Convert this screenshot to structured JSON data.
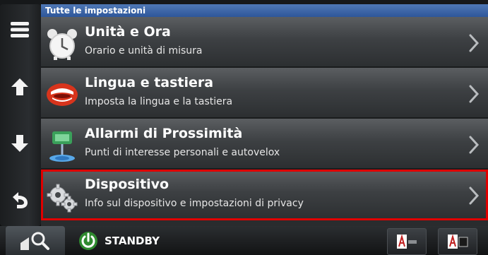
{
  "header": {
    "title": "Tutte le impostazioni"
  },
  "rows": [
    {
      "title": "Unità e Ora",
      "subtitle": "Orario e unità di misura",
      "icon": "alarm-clock-icon"
    },
    {
      "title": "Lingua e tastiera",
      "subtitle": "Imposta la lingua e la tastiera",
      "icon": "mouth-icon"
    },
    {
      "title": "Allarmi di Prossimità",
      "subtitle": "Punti di interesse personali e autovelox",
      "icon": "proximity-alert-icon"
    },
    {
      "title": "Dispositivo",
      "subtitle": "Info sul dispositivo e impostazioni di privacy",
      "icon": "gears-icon",
      "selected": true
    }
  ],
  "rail": {
    "icons": [
      "menu-icon",
      "arrow-up-icon",
      "arrow-down-icon",
      "back-icon"
    ]
  },
  "bottom": {
    "standby_label": "STANDBY"
  },
  "colors": {
    "header": "#3e66aa",
    "selection": "#e00000",
    "row": "#3d4043"
  }
}
